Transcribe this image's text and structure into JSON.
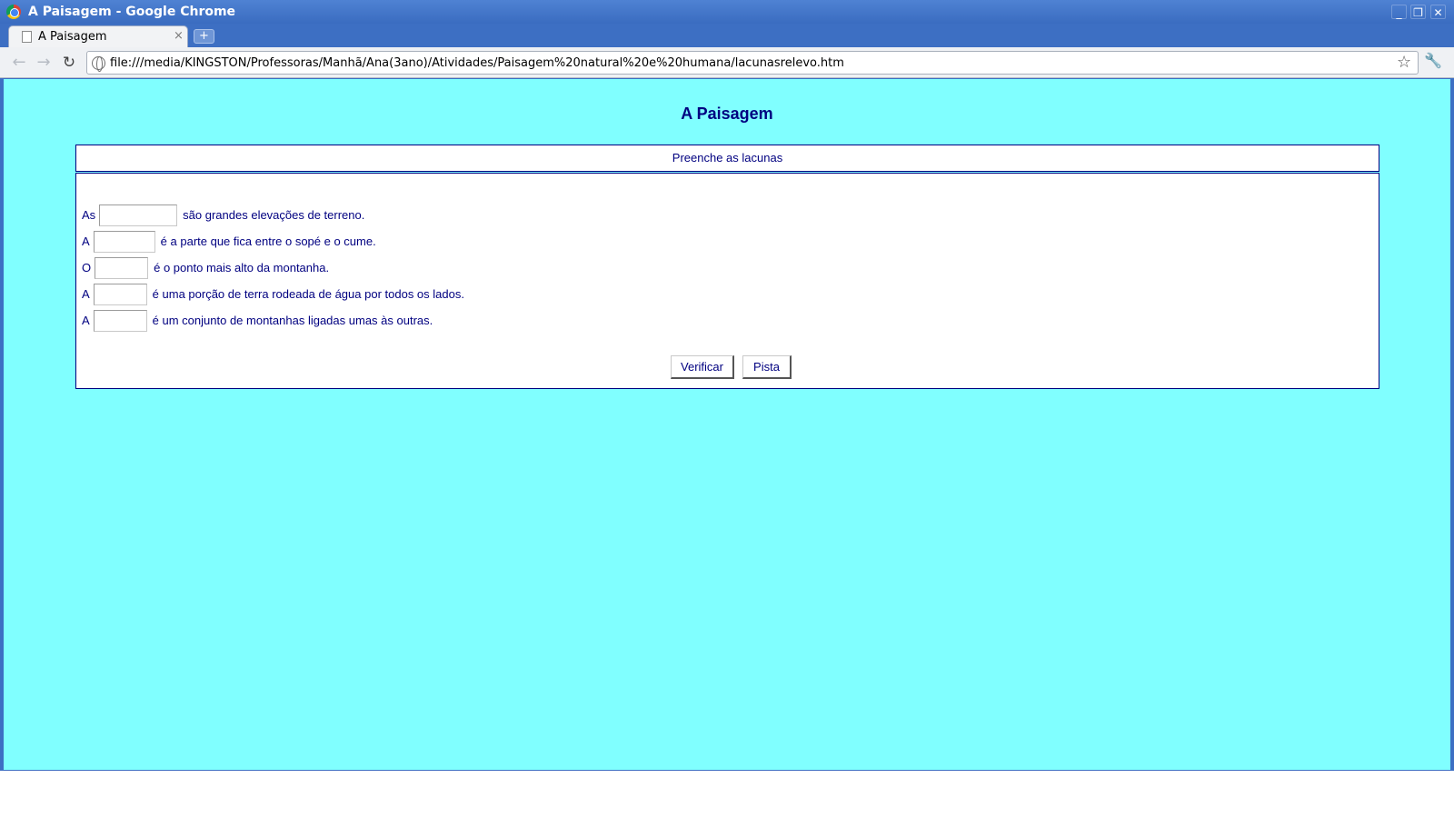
{
  "window": {
    "title": "A Paisagem - Google Chrome",
    "minimize_glyph": "_",
    "maximize_glyph": "❐",
    "close_glyph": "✕"
  },
  "tabs": [
    {
      "title": "A Paisagem",
      "close_glyph": "×",
      "active": true
    }
  ],
  "new_tab_glyph": "+",
  "toolbar": {
    "back_glyph": "←",
    "forward_glyph": "→",
    "reload_glyph": "↻",
    "url": "file:///media/KINGSTON/Professoras/Manhã/Ana(3ano)/Atividades/Paisagem%20natural%20e%20humana/lacunasrelevo.htm",
    "star_glyph": "☆",
    "wrench_glyph": "🔧"
  },
  "page": {
    "background": "#80ffff",
    "text_color": "#000080",
    "heading": "A Paisagem",
    "instructions": "Preenche as lacunas",
    "gaps": [
      {
        "before": "As",
        "value": "",
        "after": "são grandes elevações de terreno."
      },
      {
        "before": "A",
        "value": "",
        "after": "é a parte que fica entre o sopé e o cume."
      },
      {
        "before": "O",
        "value": "",
        "after": "é o ponto mais alto da montanha."
      },
      {
        "before": "A",
        "value": "",
        "after": "é uma porção de terra rodeada de água por todos os lados."
      },
      {
        "before": "A",
        "value": "",
        "after": "é um conjunto de montanhas ligadas umas às outras."
      }
    ],
    "verify_label": "Verificar",
    "hint_label": "Pista"
  }
}
